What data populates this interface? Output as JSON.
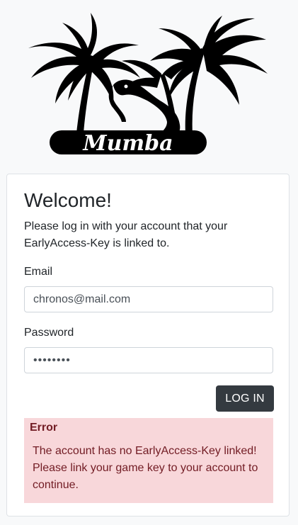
{
  "logo": {
    "brand_text": "Mumba",
    "icon": "palm-trees-snake-logo"
  },
  "login": {
    "title": "Welcome!",
    "intro": "Please log in with your account that your EarlyAccess-Key is linked to.",
    "email_label": "Email",
    "email_value": "chronos@mail.com",
    "password_label": "Password",
    "password_value": "••••••••",
    "submit_label": "LOG IN"
  },
  "error": {
    "title": "Error",
    "message": "The account has no EarlyAccess-Key linked! Please link your game key to your account to continue."
  },
  "colors": {
    "page_bg": "#f8f9fa",
    "button_bg": "#343a40",
    "alert_bg": "#f8d7da",
    "alert_text": "#721c24"
  }
}
